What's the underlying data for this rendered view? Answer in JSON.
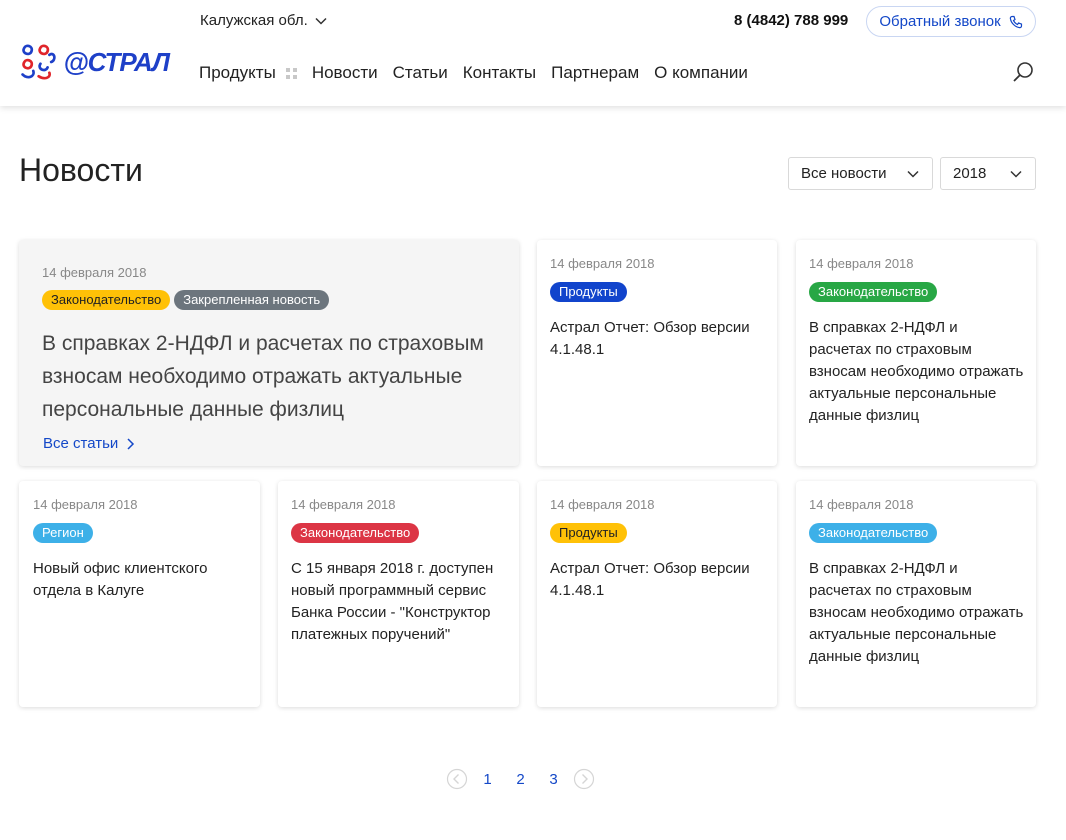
{
  "header": {
    "region": "Калужская обл.",
    "phone": "8 (4842) 788 999",
    "callback_label": "Обратный звонок",
    "logo_text": "@СТРАЛ",
    "nav": [
      {
        "label": "Продукты"
      },
      {
        "label": "Новости"
      },
      {
        "label": "Статьи"
      },
      {
        "label": "Контакты"
      },
      {
        "label": "Партнерам"
      },
      {
        "label": "О компании"
      }
    ]
  },
  "main": {
    "title": "Новости",
    "filter_category": "Все новости",
    "filter_year": "2018",
    "featured": {
      "date": "14 февраля 2018",
      "badges": [
        {
          "label": "Законодательство",
          "color": "#ffc107"
        },
        {
          "label": "Закрепленная новость",
          "color": "#6c757d"
        }
      ],
      "text": "В справках 2-НДФЛ и расчетах по страховым взносам необходимо отражать актуальные персональные данные физлиц",
      "all_link": "Все статьи"
    },
    "cards": [
      {
        "date": "14 февраля 2018",
        "badge": "Продукты",
        "badge_color": "#1144cc",
        "text": "Астрал Отчет: Обзор версии 4.1.48.1"
      },
      {
        "date": "14 февраля 2018",
        "badge": "Законодательство",
        "badge_color": "#28a745",
        "text": "В справках 2-НДФЛ и расчетах по страховым взносам необходимо отражать актуальные персональные данные физлиц"
      },
      {
        "date": "14 февраля 2018",
        "badge": "Регион",
        "badge_color": "#3db0e8",
        "text": "Новый офис клиентского отдела в Калуге"
      },
      {
        "date": "14 февраля 2018",
        "badge": "Законодательство",
        "badge_color": "#dc3545",
        "text": "С 15 января 2018 г. доступен новый программный сервис Банка России - \"Конструктор платежных поручений\""
      },
      {
        "date": "14 февраля 2018",
        "badge": "Продукты",
        "badge_color": "#ffc107",
        "text": "Астрал Отчет: Обзор версии 4.1.48.1"
      },
      {
        "date": "14 февраля 2018",
        "badge": "Законодательство",
        "badge_color": "#3db0e8",
        "text": "В справках 2-НДФЛ и расчетах по страховым взносам необходимо отражать актуальные персональные данные физлиц"
      }
    ],
    "pagination": {
      "pages": [
        "1",
        "2",
        "3"
      ]
    }
  }
}
